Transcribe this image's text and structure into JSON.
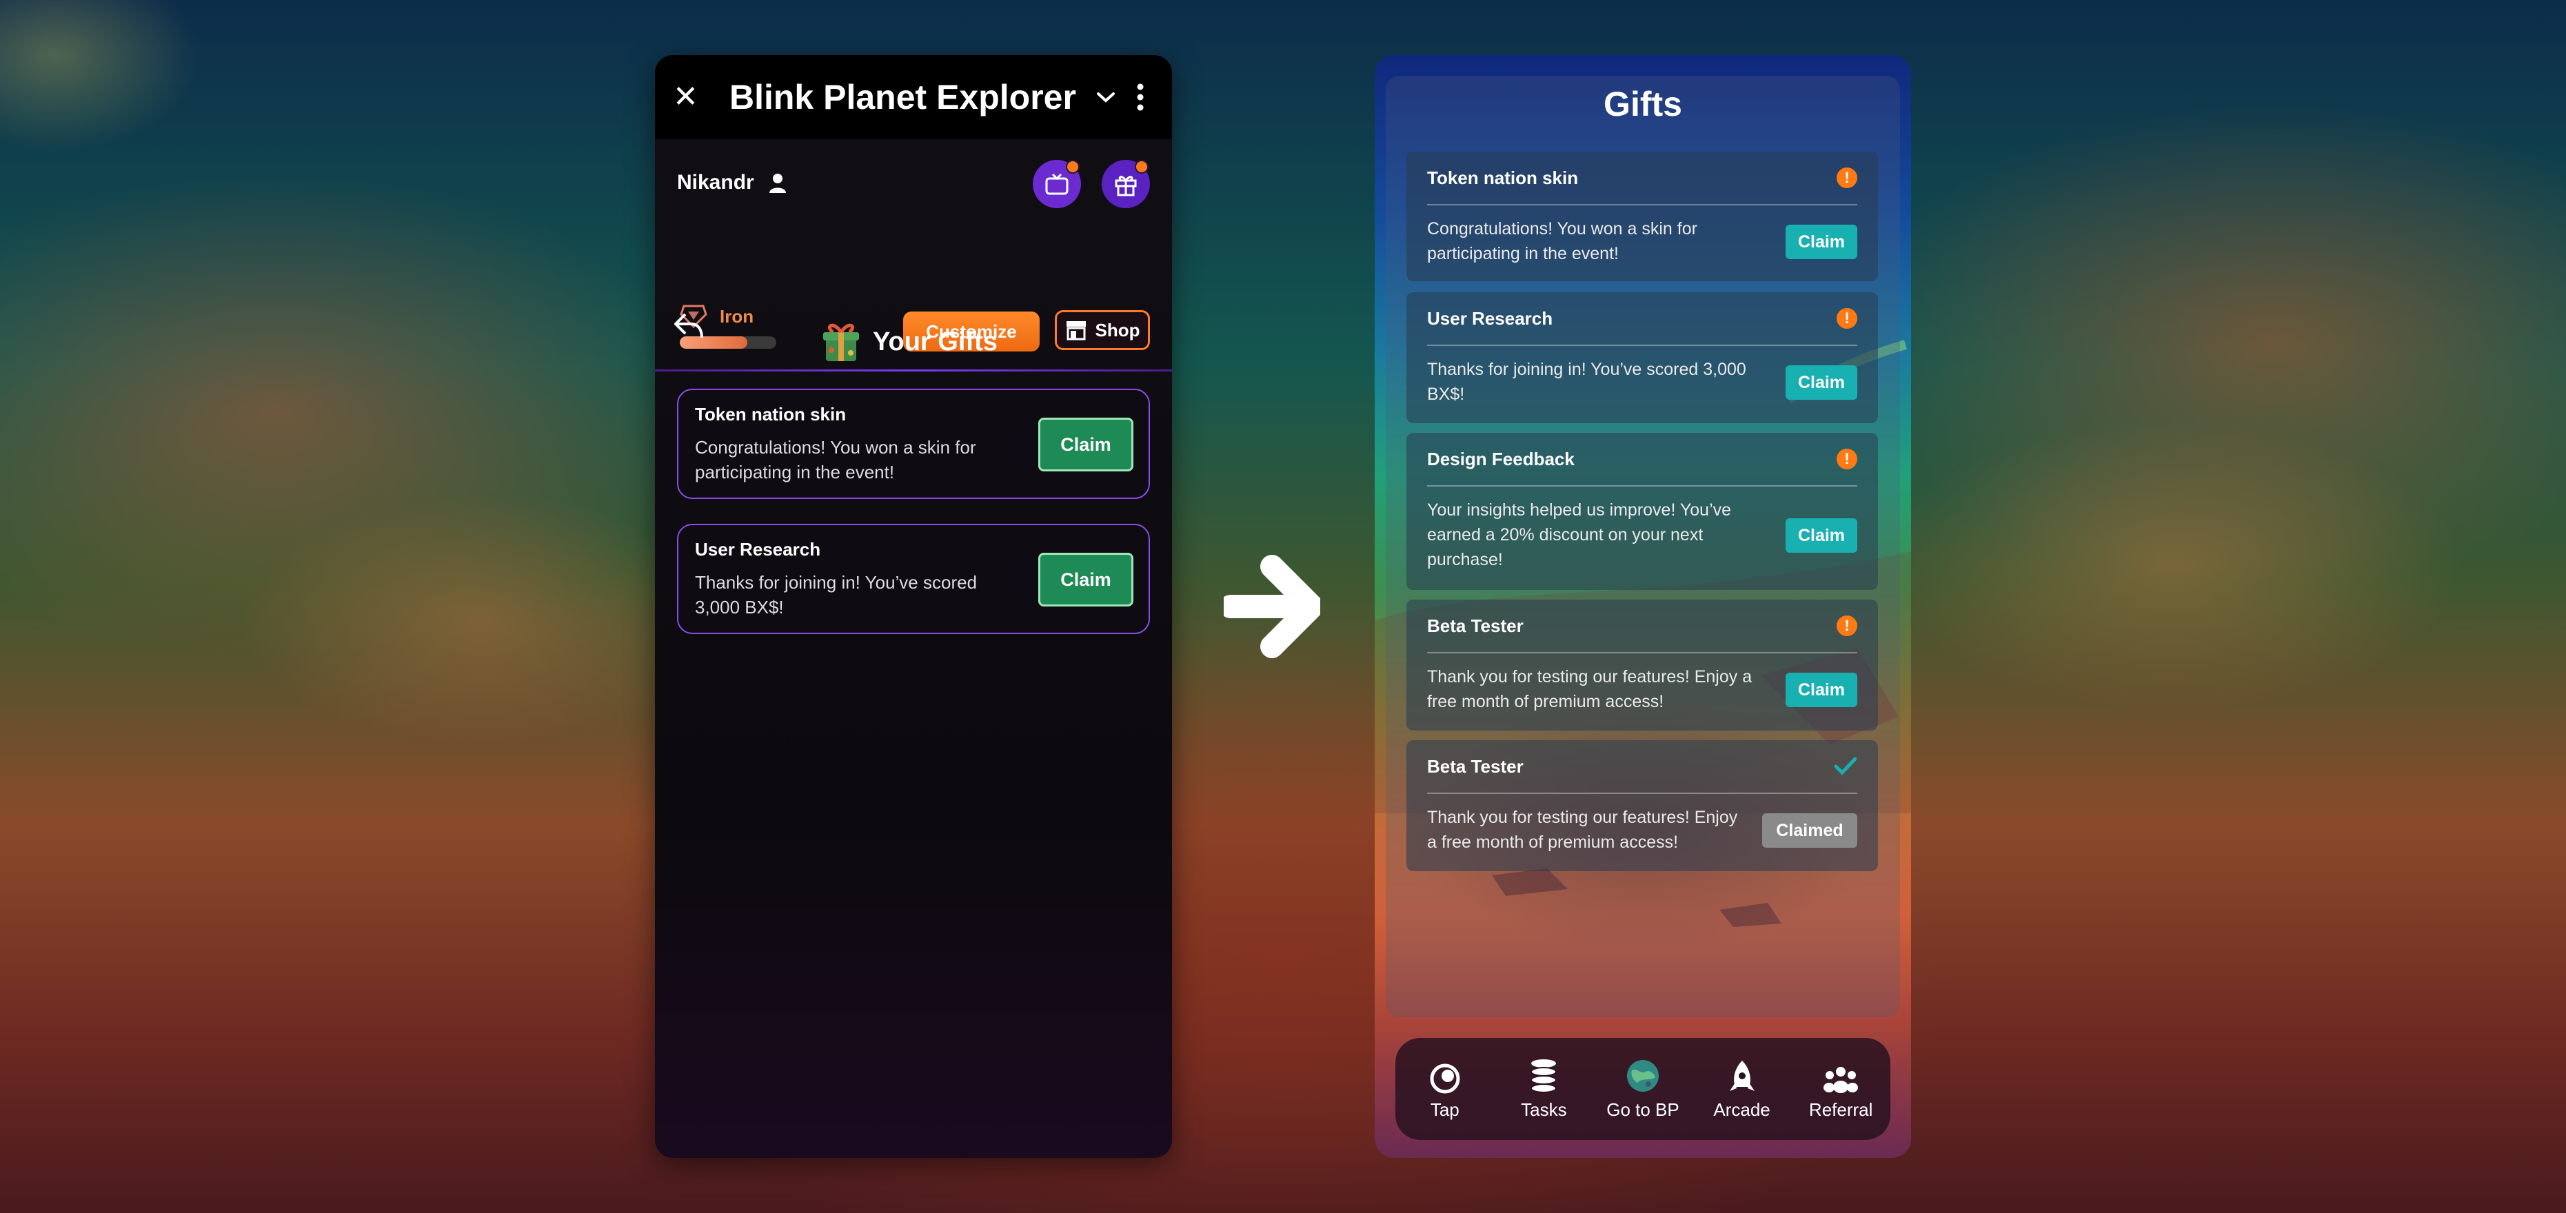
{
  "left_app": {
    "window_title": "Blink Planet Explorer",
    "player": {
      "name": "Nikandr",
      "rank": "Iron",
      "rank_progress": 0.7
    },
    "buttons": {
      "customize": "Customize",
      "shop": "Shop"
    },
    "section_title": "Your Gifts",
    "gifts": [
      {
        "title": "Token nation skin",
        "desc": "Congratulations! You won a skin for participating in the event!",
        "action": "Claim"
      },
      {
        "title": "User Research",
        "desc": "Thanks for joining in! You’ve scored 3,000 BX$!",
        "action": "Claim"
      }
    ]
  },
  "right_app": {
    "title": "Gifts",
    "gifts": [
      {
        "title": "Token nation skin",
        "desc": "Congratulations! You won a skin for participating in the event!",
        "action": "Claim",
        "status": "new"
      },
      {
        "title": "User Research",
        "desc": "Thanks for joining in! You’ve scored 3,000 BX$!",
        "action": "Claim",
        "status": "new"
      },
      {
        "title": "Design Feedback",
        "desc": "Your insights helped us improve! You’ve earned a 20% discount on your next purchase!",
        "action": "Claim",
        "status": "new"
      },
      {
        "title": "Beta Tester",
        "desc": "Thank you for testing our features! Enjoy a free month of premium access!",
        "action": "Claim",
        "status": "new"
      },
      {
        "title": "Beta Tester",
        "desc": "Thank you for testing our features! Enjoy a free month of premium access!",
        "action": "Claimed",
        "status": "claimed"
      }
    ],
    "nav": [
      {
        "label": "Tap",
        "icon": "eye-icon"
      },
      {
        "label": "Tasks",
        "icon": "coins-stack-icon"
      },
      {
        "label": "Go to BP",
        "icon": "planet-icon"
      },
      {
        "label": "Arcade",
        "icon": "rocket-icon"
      },
      {
        "label": "Referral",
        "icon": "people-icon"
      }
    ]
  },
  "colors": {
    "accent_orange": "#ff7a1a",
    "purple": "#6c2bd0",
    "claim_green": "#1e8a55",
    "claim_teal": "#18b0b0",
    "claimed_gray": "#8a8a8a"
  }
}
